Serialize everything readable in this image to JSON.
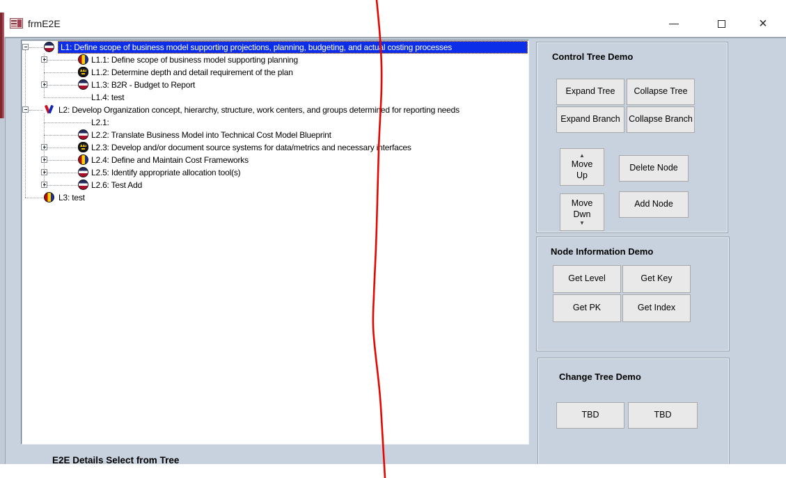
{
  "window": {
    "title": "frmE2E",
    "close_glyph": "×"
  },
  "tree": {
    "nodes": [
      {
        "level": 0,
        "expand": "minus",
        "icon": "circle-h",
        "selected": true,
        "label": "L1: Define scope of business model supporting projections, planning, budgeting, and actual costing processes"
      },
      {
        "level": 1,
        "expand": "plus",
        "icon": "circle-v",
        "selected": false,
        "label": "L1.1: Define scope of business model supporting planning"
      },
      {
        "level": 1,
        "expand": null,
        "icon": "bomb",
        "selected": false,
        "label": "L1.2: Determine depth and detail requirement of the plan"
      },
      {
        "level": 1,
        "expand": "plus",
        "icon": "circle-h",
        "selected": false,
        "label": "L1.3: B2R - Budget to Report"
      },
      {
        "level": 1,
        "expand": null,
        "icon": null,
        "selected": false,
        "label": "L1.4: test"
      },
      {
        "level": 0,
        "expand": "minus",
        "icon": "vcheck",
        "selected": false,
        "label": "L2: Develop Organization concept, hierarchy, structure, work centers, and groups determined for reporting needs"
      },
      {
        "level": 1,
        "expand": null,
        "icon": null,
        "selected": false,
        "label": "L2.1:"
      },
      {
        "level": 1,
        "expand": null,
        "icon": "circle-h",
        "selected": false,
        "label": "L2.2: Translate Business Model into Technical Cost Model Blueprint"
      },
      {
        "level": 1,
        "expand": "plus",
        "icon": "bomb",
        "selected": false,
        "label": "L2.3: Develop and/or document source systems for data/metrics and necessary interfaces"
      },
      {
        "level": 1,
        "expand": "plus",
        "icon": "circle-v",
        "selected": false,
        "label": "L2.4: Define and Maintain Cost Frameworks"
      },
      {
        "level": 1,
        "expand": "plus",
        "icon": "circle-h",
        "selected": false,
        "label": "L2.5: Identify appropriate allocation tool(s)"
      },
      {
        "level": 1,
        "expand": "plus",
        "icon": "circle-h",
        "selected": false,
        "label": "L2.6: Test Add"
      },
      {
        "level": 0,
        "expand": null,
        "icon": "circle-v",
        "selected": false,
        "label": "L3: test"
      }
    ]
  },
  "panels": {
    "control": {
      "title": "Control Tree Demo",
      "buttons": {
        "expand_tree": "Expand Tree",
        "collapse_tree": "Collapse Tree",
        "expand_branch": "Expand Branch",
        "collapse_branch": "Collapse Branch",
        "move_up": "Move Up",
        "delete_node": "Delete Node",
        "move_dwn": "Move Dwn",
        "add_node": "Add Node",
        "up_arrow": "▲",
        "down_arrow": "▼"
      }
    },
    "node_info": {
      "title": "Node Information Demo",
      "buttons": {
        "get_level": "Get Level",
        "get_key": "Get Key",
        "get_pk": "Get PK",
        "get_index": "Get Index"
      }
    },
    "change": {
      "title": "Change Tree Demo",
      "buttons": {
        "tbd1": "TBD",
        "tbd2": "TBD"
      }
    }
  },
  "footer": {
    "label": "E2E Details Select from Tree"
  },
  "colors": {
    "form_background": "#c8d2de",
    "selected_background": "#0c2ee8",
    "focus_outline": "#ff9400",
    "annotation_line": "#e60600"
  }
}
